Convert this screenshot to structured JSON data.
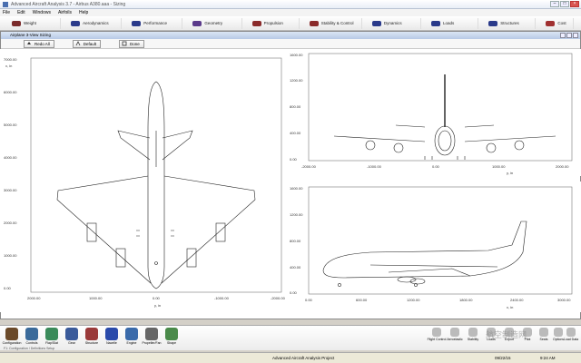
{
  "window": {
    "title": "Advanced Aircraft Analysis 3.7 - Airbus A380.aaa - Sizing"
  },
  "menu": [
    "File",
    "Edit",
    "Windows",
    "Airfoils",
    "Help"
  ],
  "toolbar": [
    {
      "label": "Weight",
      "color": "#7a2a2a"
    },
    {
      "label": "Aerodynamics",
      "color": "#2a3a8a"
    },
    {
      "label": "Performance",
      "color": "#2a3a8a"
    },
    {
      "label": "Geometry",
      "color": "#5a3a8a"
    },
    {
      "label": "Propulsion",
      "color": "#8a2a2a"
    },
    {
      "label": "Stability & Control",
      "color": "#8a2a2a"
    },
    {
      "label": "Dynamics",
      "color": "#2a3a8a"
    },
    {
      "label": "Loads",
      "color": "#2a3a8a"
    },
    {
      "label": "Structures",
      "color": "#2a3a8a"
    },
    {
      "label": "Cost",
      "color": "#a03030"
    }
  ],
  "subwindow": {
    "title": "Airplane 3-View Sizing",
    "buttons": [
      "Redo All",
      "Default",
      "Done"
    ]
  },
  "top_view": {
    "x_ticks": [
      "2000.00",
      "1000.00",
      "0.00",
      "-1000.00",
      "-2000.00"
    ],
    "y_ticks": [
      "7000.00",
      "6000.00",
      "5000.00",
      "4000.00",
      "3000.00",
      "2000.00",
      "1000.00",
      "0.00"
    ],
    "x_label": "y, in",
    "y_label": "x, in"
  },
  "front_view": {
    "x_ticks": [
      "-2000.00",
      "-1000.00",
      "0.00",
      "1000.00",
      "2000.00"
    ],
    "y_ticks": [
      "1600.00",
      "1200.00",
      "800.00",
      "400.00",
      "0.00"
    ],
    "x_label": "y, in",
    "y_label": "z, in"
  },
  "side_view": {
    "x_ticks": [
      "0.00",
      "600.00",
      "1200.00",
      "1800.00",
      "2400.00",
      "3000.00"
    ],
    "y_ticks": [
      "1600.00",
      "1200.00",
      "800.00",
      "400.00",
      "0.00"
    ],
    "x_label": "x, in",
    "y_label": "z, in"
  },
  "bottom_tools": [
    {
      "label": "Configuration",
      "color": "#6b4a2a"
    },
    {
      "label": "Controls",
      "color": "#3a6a9a"
    },
    {
      "label": "Flap/Slat",
      "color": "#3a8a5a"
    },
    {
      "label": "Gear",
      "color": "#3a5a9a"
    },
    {
      "label": "Structure",
      "color": "#9a3a3a"
    },
    {
      "label": "Nacelle",
      "color": "#2a4aaa"
    },
    {
      "label": "Engine",
      "color": "#3a6aaa"
    },
    {
      "label": "Propeller/Fan",
      "color": "#666666"
    },
    {
      "label": "Shape",
      "color": "#4a8a4a"
    }
  ],
  "right_tools": [
    "Flight Control",
    "Aeroelastic",
    "Stability",
    "Loads",
    "Export",
    "Pilot",
    "Seats",
    "Options",
    "Load Data"
  ],
  "hint": "F1: Configuration / Definitions Setup",
  "status": {
    "center": "Advanced Aircraft Analysis Project",
    "date": "09/22/15",
    "time": "9:24 AM"
  },
  "watermark": "航空制造网"
}
